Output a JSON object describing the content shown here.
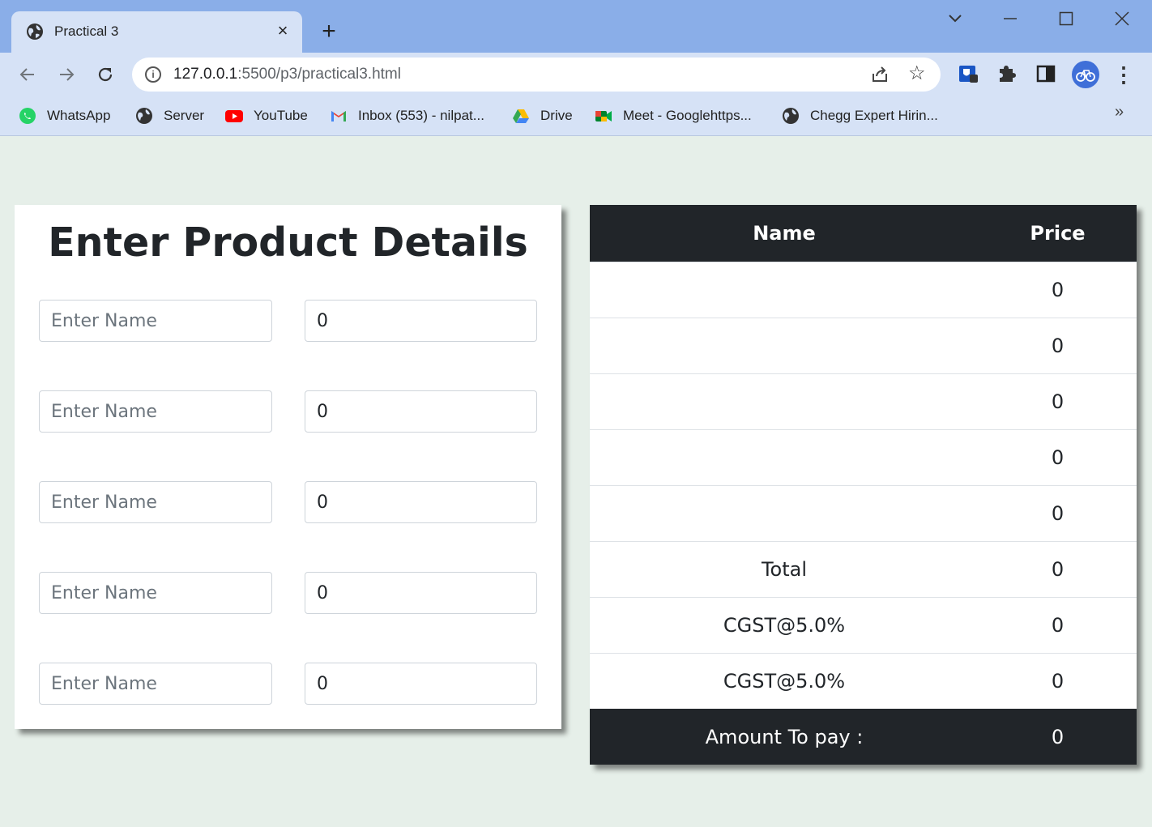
{
  "browser": {
    "tab_title": "Practical 3",
    "tab_close": "×",
    "new_tab": "+",
    "url_host": "127.0.0.1",
    "url_path": ":5500/p3/practical3.html",
    "bookmarks": [
      {
        "label": "WhatsApp",
        "icon": "whatsapp-icon"
      },
      {
        "label": "Server",
        "icon": "globe-icon"
      },
      {
        "label": "YouTube",
        "icon": "youtube-icon"
      },
      {
        "label": "Inbox (553) - nilpat...",
        "icon": "gmail-icon"
      },
      {
        "label": "Drive",
        "icon": "drive-icon"
      },
      {
        "label": "Meet - Googlehttps...",
        "icon": "meet-icon"
      },
      {
        "label": "Chegg Expert Hirin...",
        "icon": "globe-icon"
      }
    ],
    "bookmarks_more": "»"
  },
  "form": {
    "title": "Enter Product Details",
    "name_placeholder": "Enter Name",
    "rows": [
      {
        "name": "",
        "price": "0"
      },
      {
        "name": "",
        "price": "0"
      },
      {
        "name": "",
        "price": "0"
      },
      {
        "name": "",
        "price": "0"
      },
      {
        "name": "",
        "price": "0"
      }
    ]
  },
  "bill": {
    "headers": {
      "name": "Name",
      "price": "Price"
    },
    "items": [
      {
        "name": "",
        "price": "0"
      },
      {
        "name": "",
        "price": "0"
      },
      {
        "name": "",
        "price": "0"
      },
      {
        "name": "",
        "price": "0"
      },
      {
        "name": "",
        "price": "0"
      }
    ],
    "total": {
      "label": "Total",
      "value": "0"
    },
    "tax1": {
      "label": "CGST@5.0%",
      "value": "0"
    },
    "tax2": {
      "label": "CGST@5.0%",
      "value": "0"
    },
    "amount": {
      "label": "Amount To pay :",
      "value": "0"
    }
  },
  "colors": {
    "tabstrip": "#8aaee8",
    "toolbar": "#d6e2f6",
    "page_bg": "#e6efe9",
    "table_dark": "#212529"
  }
}
